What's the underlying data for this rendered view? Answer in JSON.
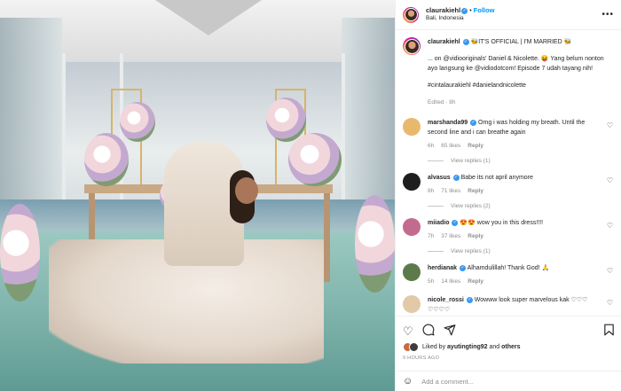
{
  "colors": {
    "accent": "#0095f6",
    "verified": "#3897f0",
    "muted": "#8e8e8e",
    "link": "#00376b"
  },
  "header": {
    "username": "claurakiehl",
    "dot": "•",
    "follow_label": "Follow",
    "location": "Bali, Indonesia",
    "more": "•••"
  },
  "caption": {
    "username": "claurakiehl",
    "headline": "🐝IT'S OFFICIAL | I'M MARRIED 🐝",
    "body": "... on @vidiooriginals' Daniel & Nicolette. 😝 Yang belum nonton ayo langsung ke @vidiodotcom! Episode 7 udah tayang nih!",
    "hashtags": "#cintalaurakiehl #danielandnicolette",
    "edited": "Edited · 8h"
  },
  "comments": [
    {
      "username": "marshanda99",
      "text": "Omg i was holding my breath. Until the second line and i can breathe again",
      "time": "6h",
      "likes": "65 likes",
      "reply": "Reply",
      "view_replies": "View replies (1)",
      "avatar_color": "#e8b86d"
    },
    {
      "username": "alvasus",
      "text": "Babe its not april anymore",
      "time": "8h",
      "likes": "71 likes",
      "reply": "Reply",
      "view_replies": "View replies (2)",
      "avatar_color": "#1e1e1e"
    },
    {
      "username": "miiadio",
      "text": "😍😍 wow you in this dress!!!!",
      "time": "7h",
      "likes": "37 likes",
      "reply": "Reply",
      "view_replies": "View replies (1)",
      "avatar_color": "#c36b8f"
    },
    {
      "username": "herdianak",
      "text": "Alhamdulillah! Thank God! 🙏",
      "time": "5h",
      "likes": "14 likes",
      "reply": "Reply",
      "view_replies": "",
      "avatar_color": "#5d7a4a"
    },
    {
      "username": "nicole_rossi",
      "text": "Wowww look super marvelous kak ♡♡♡ ♡♡♡♡",
      "time": "",
      "likes": "",
      "reply": "",
      "view_replies": "",
      "avatar_color": "#e2c9a8"
    }
  ],
  "heart_glyph": "♡",
  "actions": {
    "like_icon": "heart-icon",
    "comment_icon": "comment-icon",
    "share_icon": "share-icon",
    "save_icon": "bookmark-icon"
  },
  "likes": {
    "prefix": "Liked by",
    "user": "ayutingting92",
    "and": "and",
    "others": "others"
  },
  "time_ago": "9 HOURS AGO",
  "add_comment": {
    "placeholder": "Add a comment..."
  }
}
